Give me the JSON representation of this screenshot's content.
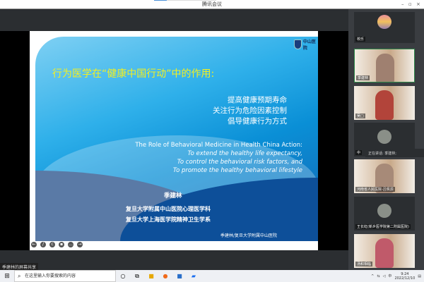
{
  "window": {
    "title": "腾讯会议"
  },
  "slide": {
    "title": "行为医学在“健康中国行动”中的作用:",
    "points_cn": [
      "提高健康预期寿命",
      "关注行为危险因素控制",
      "倡导健康行为方式"
    ],
    "en_title": "The Role of Behavioral Medicine in Health China Action:",
    "en_points": [
      "To extend the healthy life expectancy,",
      "To control the behavioral risk factors, and",
      "To promote the healthy behavioral lifestyle"
    ],
    "author": "季建林",
    "affiliations": [
      "复旦大学附属中山医院心理医学科",
      "复旦大学上海医学院精神卫生学系"
    ],
    "footer": "季建林/复旦大学附属中山医院",
    "logo_text": "中山医院"
  },
  "participants": [
    {
      "name": "校乐"
    },
    {
      "name": "季建林"
    },
    {
      "name": "吴□"
    },
    {
      "name": "中"
    },
    {
      "name": "河南省人民医院-吕佩源"
    },
    {
      "name": "王长虹(新乡医学院第二附属医院)"
    },
    {
      "name": "汤和相临"
    }
  ],
  "speaking": "正在讲话: 季建林;",
  "share_label": "季建林的屏幕共享",
  "taskbar": {
    "search_placeholder": "在这里输入你要搜索的内容",
    "time": "9:24",
    "date": "2022/12/10",
    "ime": "中"
  }
}
